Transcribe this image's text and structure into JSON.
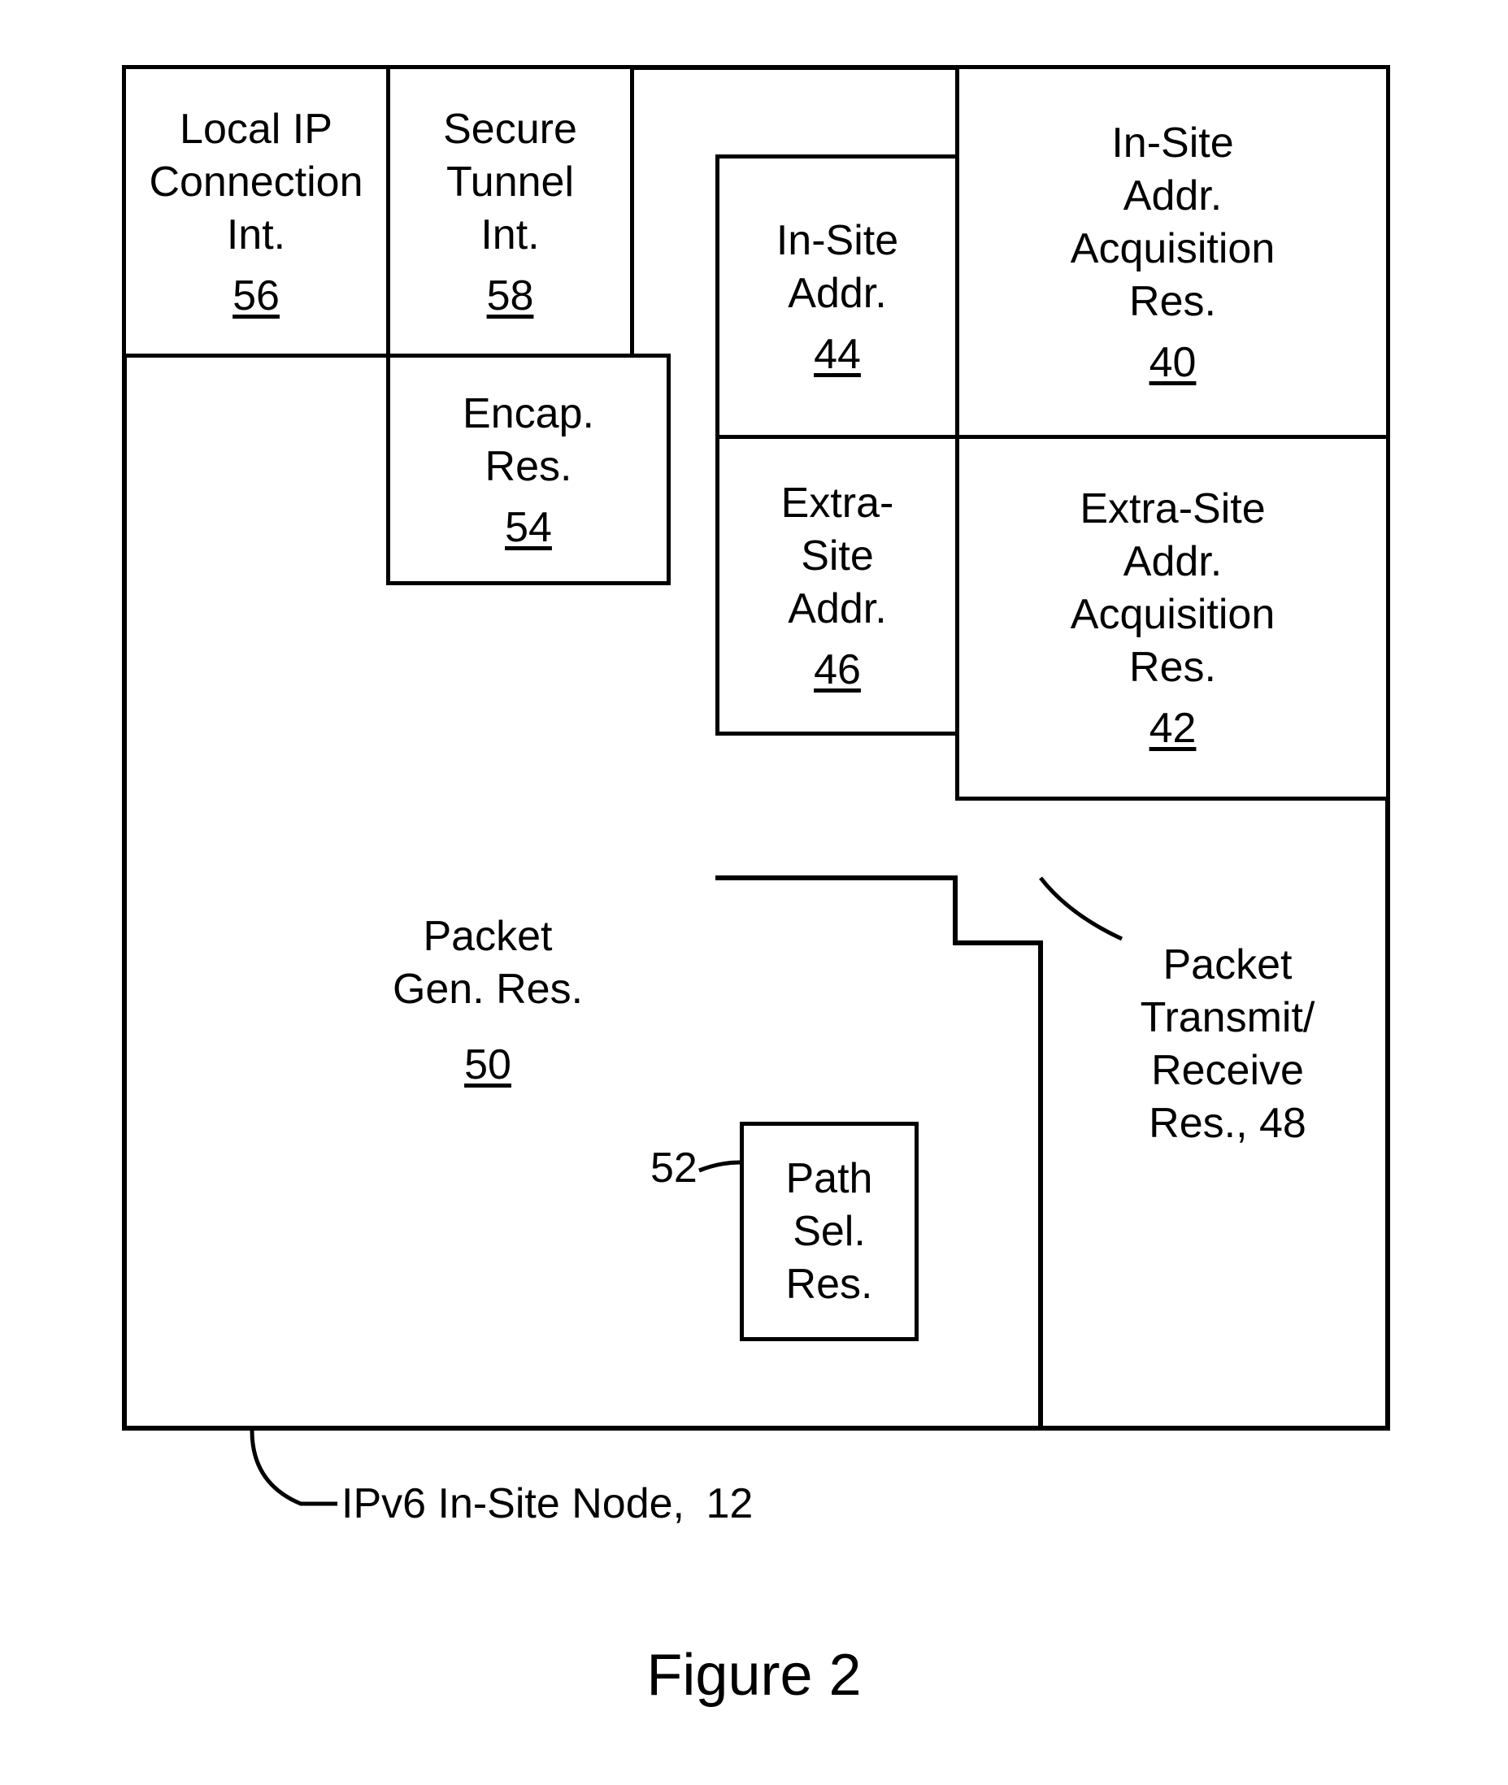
{
  "boxes": {
    "outer": {
      "caption_label": "IPv6 In-Site Node,",
      "caption_ref": "12"
    },
    "local_ip": {
      "l1": "Local IP",
      "l2": "Connection",
      "l3": "Int.",
      "ref": "56"
    },
    "secure_tun": {
      "l1": "Secure",
      "l2": "Tunnel",
      "l3": "Int.",
      "ref": "58"
    },
    "encap": {
      "l1": "Encap.",
      "l2": "Res.",
      "ref": "54"
    },
    "in_site_addr": {
      "l1": "In-Site",
      "l2": "Addr.",
      "ref": "44"
    },
    "in_site_acq": {
      "l1": "In-Site",
      "l2": "Addr.",
      "l3": "Acquisition",
      "l4": "Res.",
      "ref": "40"
    },
    "extra_site_addr": {
      "l1": "Extra-",
      "l2": "Site",
      "l3": "Addr.",
      "ref": "46"
    },
    "extra_site_acq": {
      "l1": "Extra-Site",
      "l2": "Addr.",
      "l3": "Acquisition",
      "l4": "Res.",
      "ref": "42"
    },
    "pkt_gen": {
      "l1": "Packet",
      "l2": "Gen. Res.",
      "ref": "50"
    },
    "path_sel": {
      "l1": "Path",
      "l2": "Sel.",
      "l3": "Res.",
      "ref_external": "52"
    },
    "pkt_trx": {
      "l1": "Packet",
      "l2": "Transmit/",
      "l3": "Receive",
      "l4": "Res., 48"
    }
  },
  "figure_caption": "Figure 2"
}
